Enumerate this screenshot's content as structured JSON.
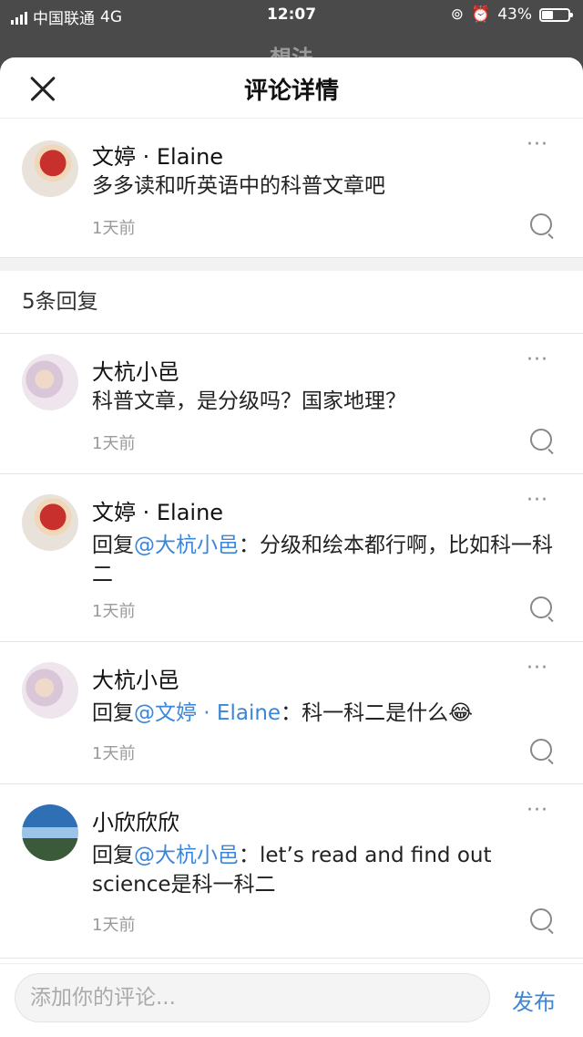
{
  "status_bar": {
    "carrier": "中国联通",
    "network": "4G",
    "time": "12:07",
    "battery": "43%",
    "battery_level": 0.43
  },
  "underlay": {
    "title": "想法"
  },
  "sheet": {
    "title": "评论详情"
  },
  "main_comment": {
    "author": "文婷 · Elaine",
    "text": "多多读和听英语中的科普文章吧",
    "time": "1天前"
  },
  "replies_count": "5条回复",
  "replies": [
    {
      "author": "大杭小邑",
      "prefix": "",
      "mention": "",
      "sep": "",
      "text": "科普文章，是分级吗？国家地理？",
      "time": "1天前"
    },
    {
      "author": "文婷 · Elaine",
      "prefix": "回复",
      "mention": "@大杭小邑",
      "sep": "：",
      "text": "分级和绘本都行啊，比如科一科二",
      "time": "1天前"
    },
    {
      "author": "大杭小邑",
      "prefix": "回复",
      "mention": "@文婷 · Elaine",
      "sep": "：",
      "text": "科一科二是什么😂",
      "time": "1天前"
    },
    {
      "author": "小欣欣欣",
      "prefix": "回复",
      "mention": "@大杭小邑",
      "sep": "：",
      "text": "let’s read and find out science是科一科二",
      "time": "1天前"
    }
  ],
  "footer": {
    "placeholder": "添加你的评论...",
    "post_label": "发布"
  },
  "colors": {
    "accent": "#3b86d8"
  }
}
